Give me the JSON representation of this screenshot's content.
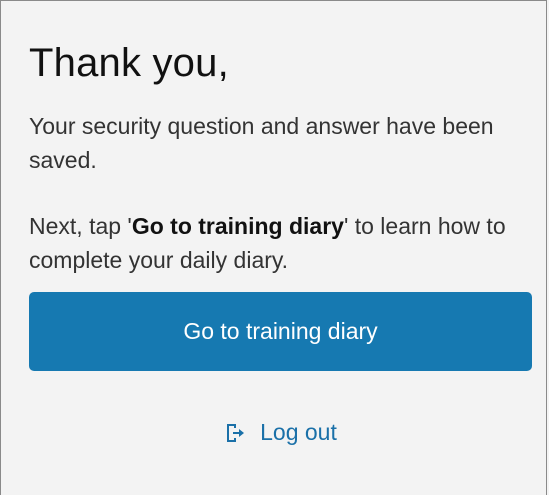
{
  "heading": "Thank you,",
  "message_saved": "Your security question and answer have been saved.",
  "next_prefix": "Next, tap '",
  "next_bold": "Go to training diary",
  "next_suffix": "' to learn how to complete your daily diary.",
  "primary_button_label": "Go to training diary",
  "logout_label": "Log out",
  "colors": {
    "primary": "#1679b1",
    "link": "#1a70a8",
    "background": "#f3f3f3"
  },
  "icons": {
    "logout": "log-out-icon"
  }
}
